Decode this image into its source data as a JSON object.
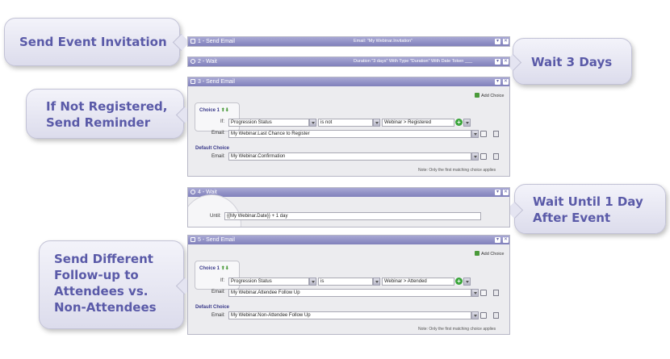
{
  "callouts": {
    "c1": "Send Event Invitation",
    "c2": "Wait 3 Days",
    "c3_line1": "If Not Registered,",
    "c3_line2": "Send Reminder",
    "c4_line1": "Wait Until 1 Day",
    "c4_line2": "After Event",
    "c5_line1": "Send Different",
    "c5_line2": "Follow-up to",
    "c5_line3": "Attendees vs.",
    "c5_line4": "Non-Attendees"
  },
  "steps": {
    "s1": {
      "title": "1 - Send Email",
      "desc": "Email: \"My Webinar.Invitation\""
    },
    "s2": {
      "title": "2 - Wait",
      "desc": "Duration \"3 days\" With Type \"Duration\" With Date Token ___"
    },
    "s3": {
      "title": "3 - Send Email",
      "add_choice": "Add Choice",
      "choice_label": "Choice 1",
      "if_label": "If:",
      "condition_field": "Progression Status",
      "operator": "is not",
      "value": "Webinar > Registered",
      "email_label": "Email:",
      "email": "My Webinar.Last Chance to Register",
      "default_label": "Default Choice",
      "default_email_label": "Email:",
      "default_email": "My Webinar.Confirmation",
      "note": "Note: Only the first matching choice applies"
    },
    "s4": {
      "title": "4 - Wait",
      "until_label": "Until:",
      "until_value": "{{My Webinar.Date}} + 1 day"
    },
    "s5": {
      "title": "5 - Send Email",
      "add_choice": "Add Choice",
      "choice_label": "Choice 1",
      "if_label": "If:",
      "condition_field": "Progression Status",
      "operator": "is",
      "value": "Webinar > Attended",
      "email_label": "Email:",
      "email": "My Webinar.Attendee Follow Up",
      "default_label": "Default Choice",
      "default_email_label": "Email:",
      "default_email": "My Webinar.Non-Attendee Follow Up",
      "note": "Note: Only the first matching choice applies"
    }
  },
  "glyphs": {
    "minimize": "▾",
    "close": "✕",
    "plus": "+",
    "arrows": "⬆⬇"
  },
  "colors": {
    "header": "#8f8fc6",
    "callout_text": "#5a5aa8",
    "panel": "#ececef",
    "add": "#3aa53a"
  }
}
